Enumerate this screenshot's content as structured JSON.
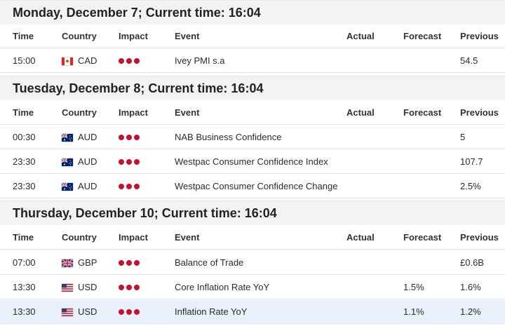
{
  "columns": {
    "time": "Time",
    "country": "Country",
    "impact": "Impact",
    "event": "Event",
    "actual": "Actual",
    "forecast": "Forecast",
    "previous": "Previous"
  },
  "days": [
    {
      "title": "Monday, December 7; Current time: 16:04",
      "rows": [
        {
          "time": "15:00",
          "country": "CAD",
          "flag": "canada-flag-icon",
          "impact": 3,
          "event": "Ivey PMI s.a",
          "actual": "",
          "forecast": "",
          "previous": "54.5"
        }
      ]
    },
    {
      "title": "Tuesday, December 8; Current time: 16:04",
      "rows": [
        {
          "time": "00:30",
          "country": "AUD",
          "flag": "australia-flag-icon",
          "impact": 3,
          "event": "NAB Business Confidence",
          "actual": "",
          "forecast": "",
          "previous": "5"
        },
        {
          "time": "23:30",
          "country": "AUD",
          "flag": "australia-flag-icon",
          "impact": 3,
          "event": "Westpac Consumer Confidence Index",
          "actual": "",
          "forecast": "",
          "previous": "107.7"
        },
        {
          "time": "23:30",
          "country": "AUD",
          "flag": "australia-flag-icon",
          "impact": 3,
          "event": "Westpac Consumer Confidence Change",
          "actual": "",
          "forecast": "",
          "previous": "2.5%"
        }
      ]
    },
    {
      "title": "Thursday, December 10; Current time: 16:04",
      "rows": [
        {
          "time": "07:00",
          "country": "GBP",
          "flag": "uk-flag-icon",
          "impact": 3,
          "event": "Balance of Trade",
          "actual": "",
          "forecast": "",
          "previous": "£0.6B"
        },
        {
          "time": "13:30",
          "country": "USD",
          "flag": "us-flag-icon",
          "impact": 3,
          "event": "Core Inflation Rate YoY",
          "actual": "",
          "forecast": "1.5%",
          "previous": "1.6%"
        },
        {
          "time": "13:30",
          "country": "USD",
          "flag": "us-flag-icon",
          "impact": 3,
          "event": "Inflation Rate YoY",
          "actual": "",
          "forecast": "1.1%",
          "previous": "1.2%",
          "highlighted": true
        }
      ]
    }
  ],
  "colors": {
    "impact_high": "#c8102e",
    "section_background": "#f2f3f5",
    "highlight_row": "#e8f0fb"
  }
}
